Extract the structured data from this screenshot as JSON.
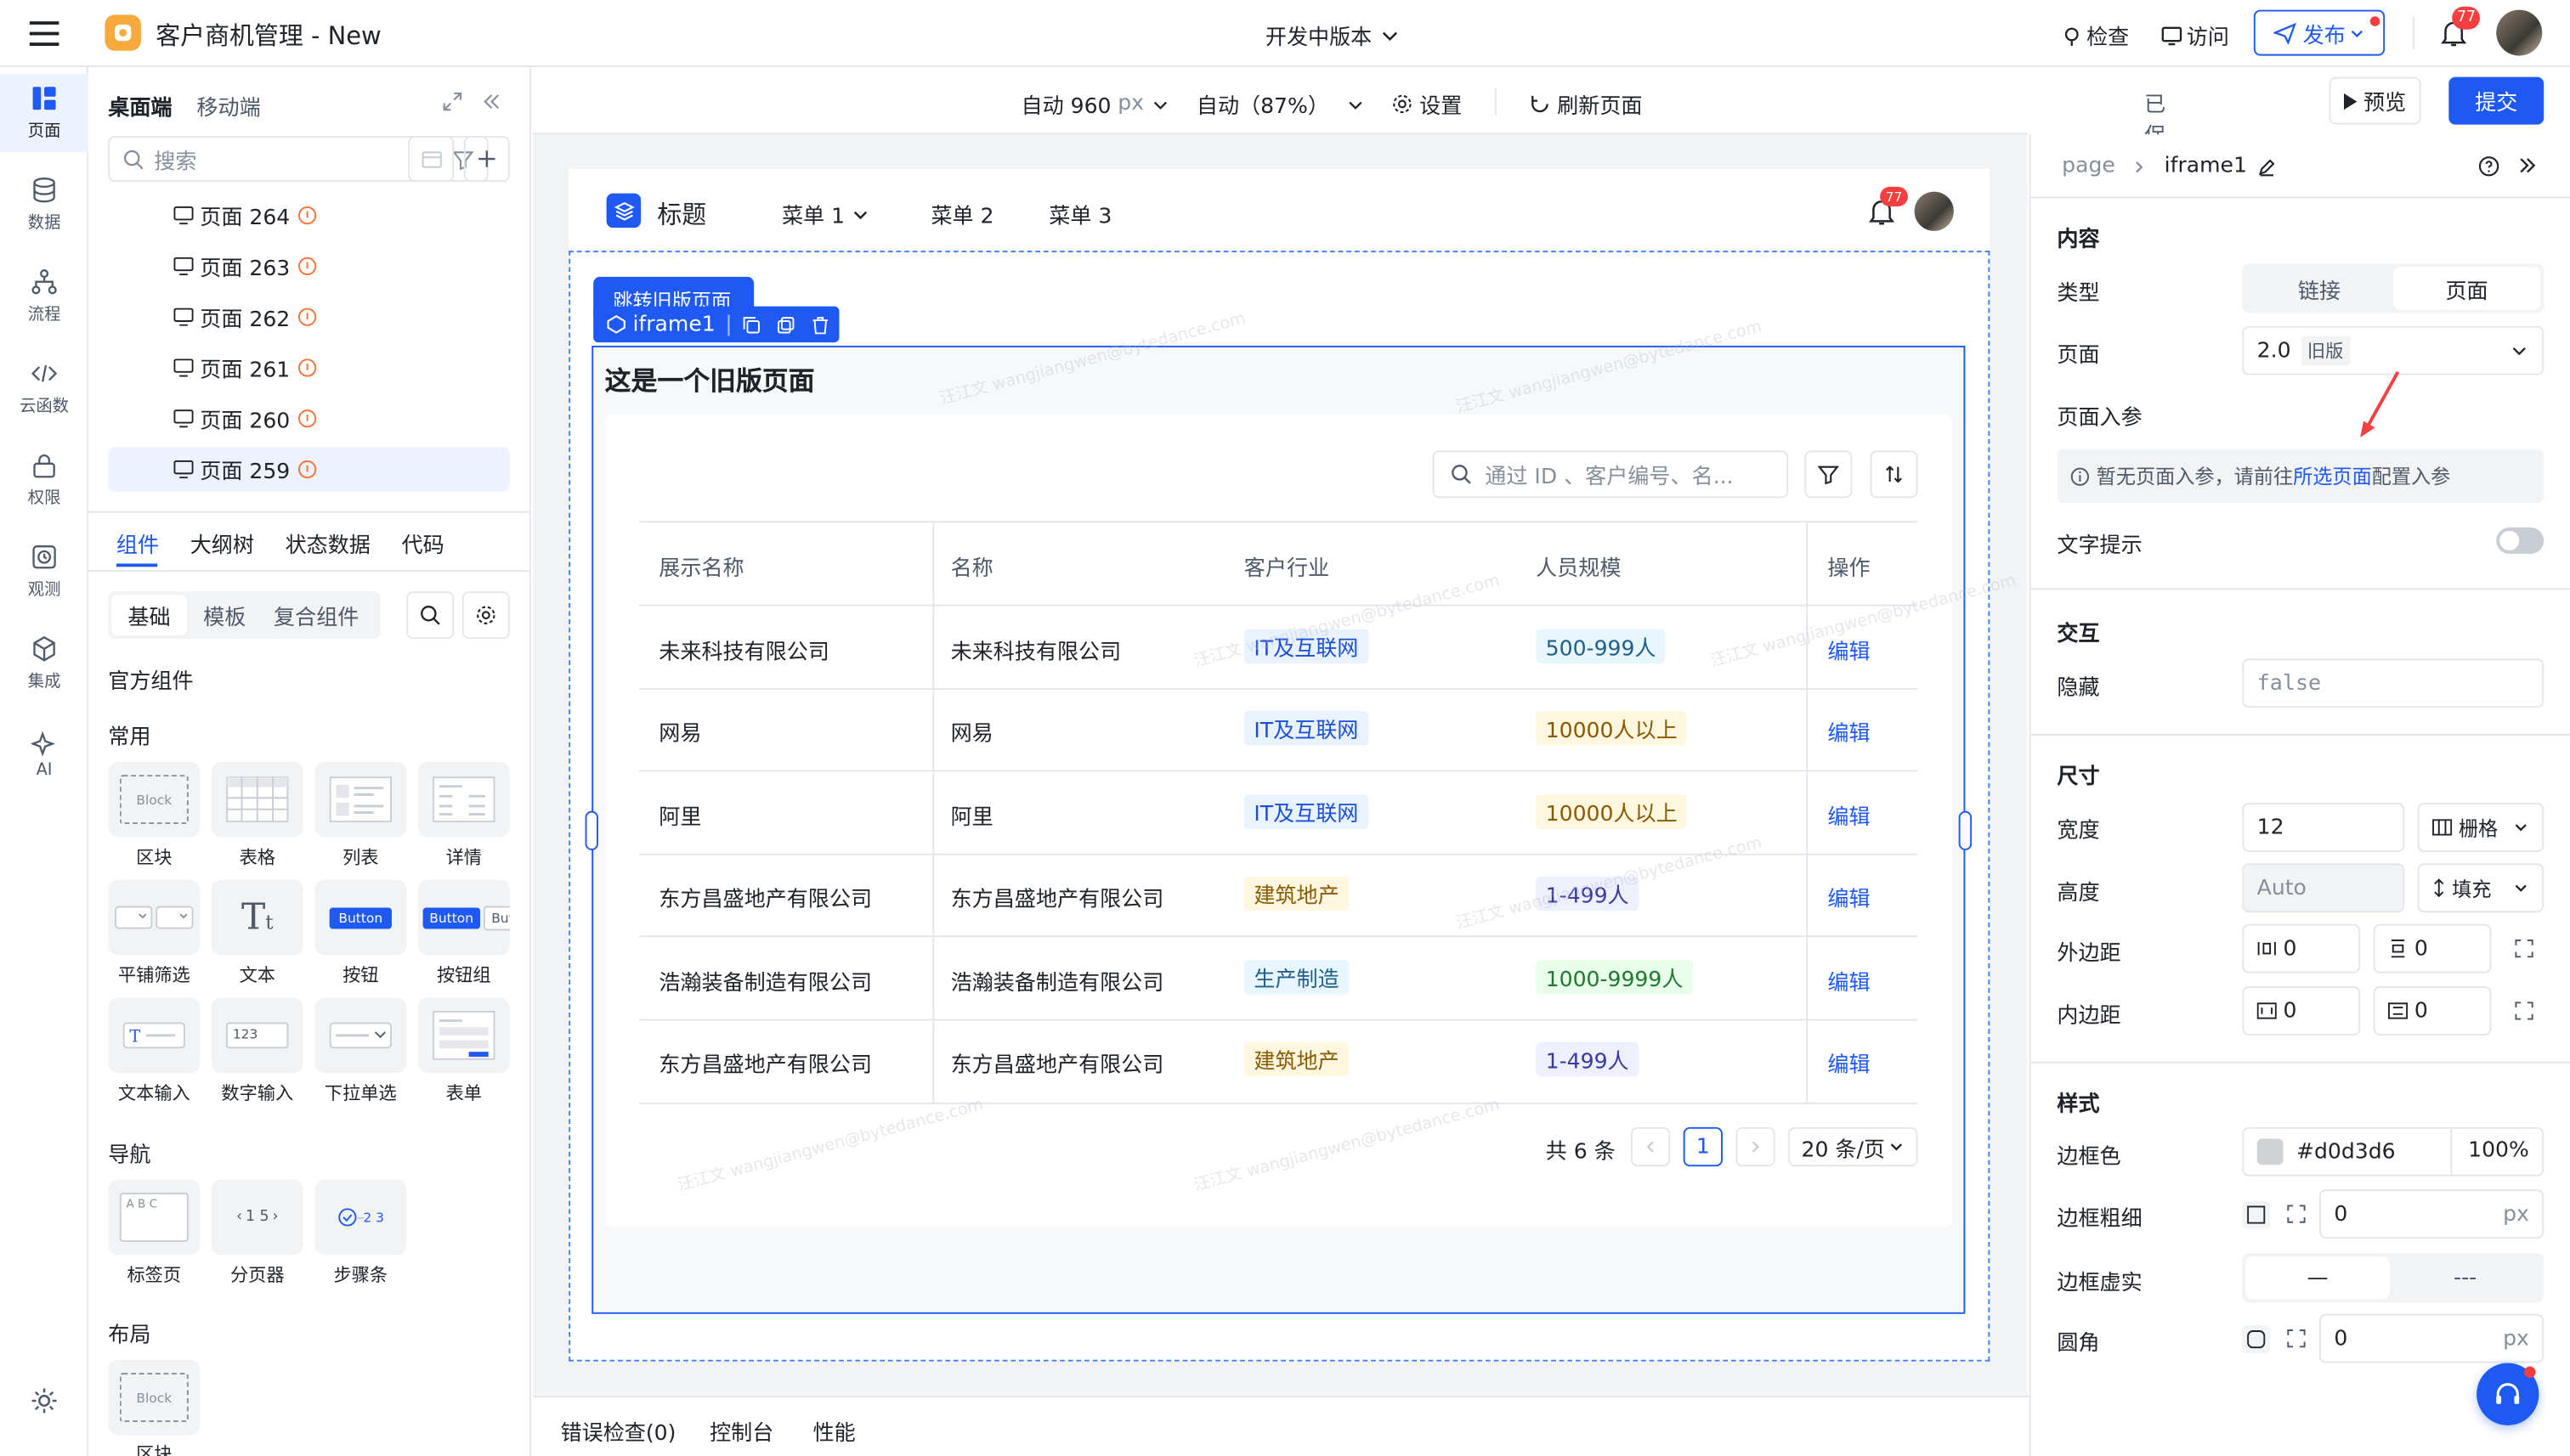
{
  "app": {
    "title": "客户商机管理 - New",
    "version": "开发中版本"
  },
  "topbar": {
    "inspect": "检查",
    "visit": "访问",
    "publish": "发布",
    "notif_count": "77"
  },
  "rail": [
    {
      "label": "页面",
      "icon": "page-icon"
    },
    {
      "label": "数据",
      "icon": "database-icon"
    },
    {
      "label": "流程",
      "icon": "flow-icon"
    },
    {
      "label": "云函数",
      "icon": "code-icon"
    },
    {
      "label": "权限",
      "icon": "lock-icon"
    },
    {
      "label": "观测",
      "icon": "monitor-icon"
    },
    {
      "label": "集成",
      "icon": "cube-icon"
    },
    {
      "label": "AI",
      "icon": "sparkle-icon"
    }
  ],
  "leftpanel": {
    "tab_desktop": "桌面端",
    "tab_mobile": "移动端",
    "search_placeholder": "搜索",
    "pages": [
      "页面 264",
      "页面 263",
      "页面 262",
      "页面 261",
      "页面 260",
      "页面 259"
    ],
    "tabs": [
      "组件",
      "大纲树",
      "状态数据",
      "代码"
    ],
    "subtabs": [
      "基础",
      "模板",
      "复合组件"
    ],
    "official": "官方组件",
    "common": "常用",
    "components": [
      "区块",
      "表格",
      "列表",
      "详情",
      "平铺筛选",
      "文本",
      "按钮",
      "按钮组",
      "文本输入",
      "数字输入",
      "下拉单选",
      "表单"
    ],
    "nav": "导航",
    "nav_components": [
      "标签页",
      "分页器",
      "步骤条"
    ],
    "layout": "布局",
    "layout_components": [
      "区块"
    ],
    "block_text": "Block",
    "button_text": "Button",
    "pager_text": "1 5",
    "num_text": "123",
    "tabs_text": "A B C",
    "steps_text": "2 3"
  },
  "toolbar": {
    "width": "自动 960",
    "width_unit": "px",
    "zoom": "自动（87%）",
    "settings": "设置",
    "refresh": "刷新页面",
    "saved": "已保存未提交",
    "preview": "预览",
    "submit": "提交"
  },
  "preview": {
    "title": "标题",
    "menus": [
      "菜单 1",
      "菜单 2",
      "菜单 3"
    ],
    "badge": "77",
    "jump_label": "跳转旧版页面",
    "iframe_label": "iframe1",
    "heading": "这是一个旧版页面",
    "search_placeholder": "通过 ID 、客户编号、名...",
    "columns": [
      "展示名称",
      "名称",
      "客户行业",
      "人员规模",
      "操作"
    ],
    "rows": [
      {
        "display": "未来科技有限公司",
        "name": "未来科技有限公司",
        "industry": "IT及互联网",
        "size": "500-999人",
        "action": "编辑"
      },
      {
        "display": "网易",
        "name": "网易",
        "industry": "IT及互联网",
        "size": "10000人以上",
        "action": "编辑"
      },
      {
        "display": "阿里",
        "name": "阿里",
        "industry": "IT及互联网",
        "size": "10000人以上",
        "action": "编辑"
      },
      {
        "display": "东方昌盛地产有限公司",
        "name": "东方昌盛地产有限公司",
        "industry": "建筑地产",
        "size": "1-499人",
        "action": "编辑"
      },
      {
        "display": "浩瀚装备制造有限公司",
        "name": "浩瀚装备制造有限公司",
        "industry": "生产制造",
        "size": "1000-9999人",
        "action": "编辑"
      },
      {
        "display": "东方昌盛地产有限公司",
        "name": "东方昌盛地产有限公司",
        "industry": "建筑地产",
        "size": "1-499人",
        "action": "编辑"
      }
    ],
    "total": "共 6 条",
    "page": "1",
    "page_size": "20 条/页",
    "watermark": "汪江文 wangjiangwen@bytedance.com"
  },
  "rightpanel": {
    "breadcrumb_root": "page",
    "breadcrumb_current": "iframe1",
    "content": "内容",
    "type_label": "类型",
    "type_link": "链接",
    "type_page": "页面",
    "page_label": "页面",
    "page_value": "2.0",
    "page_tag": "旧版",
    "params_label": "页面入参",
    "params_hint_pre": "暂无页面入参，请前往",
    "params_hint_link": "所选页面",
    "params_hint_post": "配置入参",
    "tooltip_label": "文字提示",
    "interaction": "交互",
    "hidden_label": "隐藏",
    "hidden_value": "false",
    "size": "尺寸",
    "width_label": "宽度",
    "width_value": "12",
    "width_mode": "栅格",
    "height_label": "高度",
    "height_value": "Auto",
    "height_mode": "填充",
    "margin_label": "外边距",
    "margin_x": "0",
    "margin_y": "0",
    "padding_label": "内边距",
    "padding_x": "0",
    "padding_y": "0",
    "style": "样式",
    "border_color_label": "边框色",
    "border_color_value": "#d0d3d6",
    "border_opacity": "100%",
    "border_width_label": "边框粗细",
    "border_width_value": "0",
    "unit": "px",
    "border_style_label": "边框虚实",
    "border_solid": "—",
    "border_dashed": "---",
    "radius_label": "圆角",
    "radius_value": "0"
  },
  "bottombar": {
    "tabs": [
      "错误检查(0)",
      "控制台",
      "性能"
    ]
  },
  "colors": {
    "primary": "#1d59f2",
    "warn": "#f77234",
    "red": "#f53f3f"
  }
}
